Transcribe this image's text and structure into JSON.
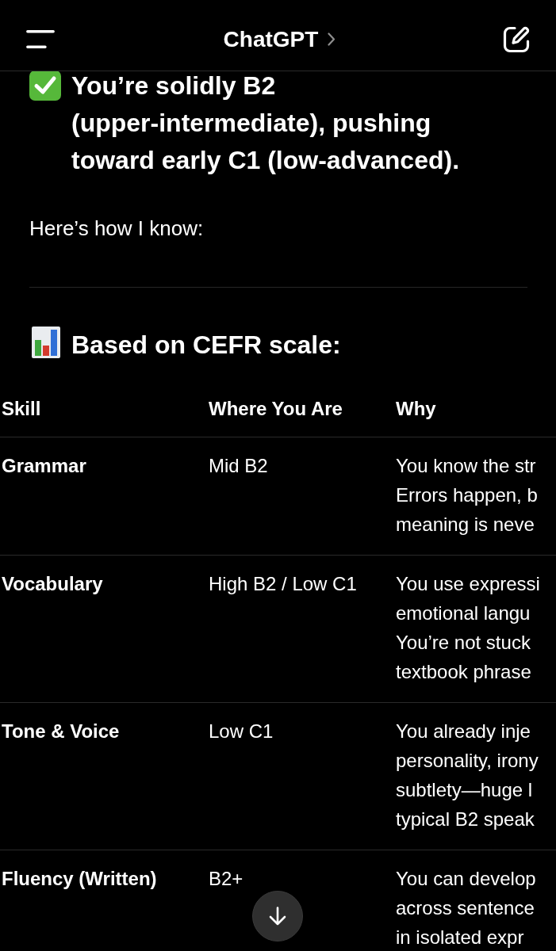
{
  "top_bar": {
    "title": "ChatGPT"
  },
  "message": {
    "headline": "You’re solidly B2 (upper-intermediate), pushing toward early C1 (low-advanced).",
    "intro": "Here’s how I know:",
    "section_heading": "Based on CEFR scale:"
  },
  "table": {
    "columns": [
      "Skill",
      "Where You Are",
      "Why"
    ],
    "rows": [
      {
        "skill": "Grammar",
        "where": "Mid B2",
        "why": [
          "You know the str",
          "Errors happen, b",
          "meaning is neve"
        ]
      },
      {
        "skill": "Vocabulary",
        "where": "High B2 / Low C1",
        "why": [
          "You use expressi",
          "emotional langu",
          "You’re not stuck",
          "textbook phrase"
        ]
      },
      {
        "skill": "Tone & Voice",
        "where": "Low C1",
        "why": [
          "You already inje",
          "personality, irony",
          "subtlety—huge l",
          "typical B2 speak"
        ]
      },
      {
        "skill": "Fluency (Written)",
        "where": "B2+",
        "why": [
          "You can develop",
          "across sentence",
          "in isolated expr"
        ]
      }
    ]
  }
}
